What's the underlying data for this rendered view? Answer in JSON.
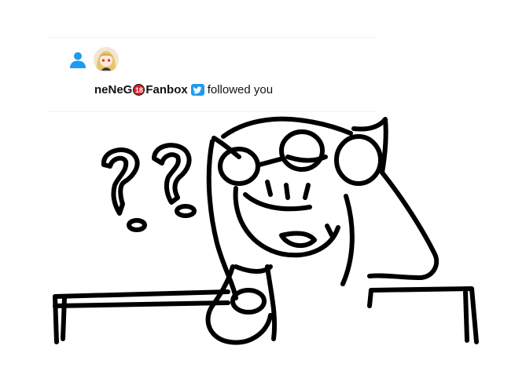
{
  "notification": {
    "user_name_part1": "neNeG",
    "age_badge": "18",
    "user_name_part2": "Fanbox",
    "action_text": "followed you",
    "icons": {
      "follow": "person-icon",
      "avatar": "avatar",
      "platform": "twitter-bird-icon"
    },
    "colors": {
      "accent": "#1d9bf0",
      "text": "#0f1419"
    }
  }
}
